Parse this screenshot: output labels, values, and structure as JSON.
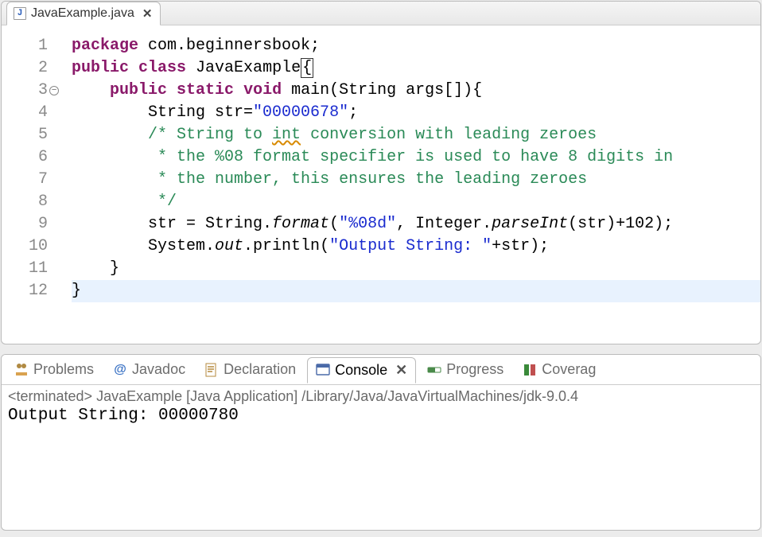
{
  "editor": {
    "tab_filename": "JavaExample.java",
    "file_icon_letter": "J",
    "lines": {
      "l1": {
        "n": "1"
      },
      "l2": {
        "n": "2"
      },
      "l3": {
        "n": "3"
      },
      "l4": {
        "n": "4"
      },
      "l5": {
        "n": "5"
      },
      "l6": {
        "n": "6"
      },
      "l7": {
        "n": "7"
      },
      "l8": {
        "n": "8"
      },
      "l9": {
        "n": "9"
      },
      "l10": {
        "n": "10"
      },
      "l11": {
        "n": "11"
      },
      "l12": {
        "n": "12"
      }
    },
    "code": {
      "l1_kw1": "package",
      "l1_rest": " com.beginnersbook;",
      "l2_kw1": "public",
      "l2_kw2": "class",
      "l2_name": " JavaExample",
      "l2_brace": "{",
      "l3_indent": "    ",
      "l3_kw1": "public",
      "l3_kw2": "static",
      "l3_kw3": "void",
      "l3_sig": " main(String args[]){",
      "l4_indent": "        ",
      "l4_a": "String str=",
      "l4_str": "\"00000678\"",
      "l4_b": ";",
      "l5_indent": "        ",
      "l5_cmt_a": "/* String to ",
      "l5_cmt_int": "int",
      "l5_cmt_b": " conversion with leading zeroes",
      "l6_indent": "         ",
      "l6_cmt": "* the %08 format specifier is used to have 8 digits in",
      "l7_indent": "         ",
      "l7_cmt": "* the number, this ensures the leading zeroes",
      "l8_indent": "         ",
      "l8_cmt": "*/",
      "l9_indent": "        ",
      "l9_a": "str = String.",
      "l9_format": "format",
      "l9_b": "(",
      "l9_str": "\"%08d\"",
      "l9_c": ", Integer.",
      "l9_parse": "parseInt",
      "l9_d": "(str)+102);",
      "l10_indent": "        ",
      "l10_a": "System.",
      "l10_out": "out",
      "l10_b": ".println(",
      "l10_str": "\"Output String: \"",
      "l10_c": "+str);",
      "l11_indent": "    ",
      "l11_a": "}",
      "l12_a": "}"
    }
  },
  "bottom": {
    "tabs": {
      "problems": "Problems",
      "javadoc": "Javadoc",
      "declaration": "Declaration",
      "console": "Console",
      "progress": "Progress",
      "coverage": "Coverag"
    },
    "console_header": "<terminated> JavaExample [Java Application] /Library/Java/JavaVirtualMachines/jdk-9.0.4",
    "console_output": "Output String: 00000780"
  },
  "fold_glyph": "−"
}
